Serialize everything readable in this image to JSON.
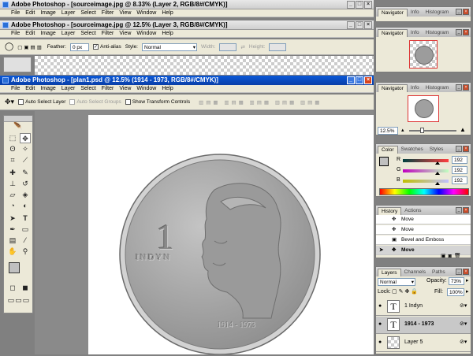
{
  "windows": {
    "w1": {
      "title": "Adobe Photoshop - [sourceimage.jpg @ 8.33% (Layer 2, RGB/8#/CMYK)]"
    },
    "w2": {
      "title": "Adobe Photoshop - [sourceimage.jpg @ 12.5% (Layer 3, RGB/8#/CMYK)]"
    },
    "w3": {
      "title": "Adobe Photoshop - [plan1.psd @ 12.5% (1914 - 1973, RGB/8#/CMYK)]"
    }
  },
  "menu": [
    "File",
    "Edit",
    "Image",
    "Layer",
    "Select",
    "Filter",
    "View",
    "Window",
    "Help"
  ],
  "options_marquee": {
    "feather_label": "Feather:",
    "feather_value": "0 px",
    "antialias_label": "Anti-alias",
    "style_label": "Style:",
    "style_value": "Normal",
    "width_label": "Width:",
    "height_label": "Height:"
  },
  "options_move": {
    "auto_select_layer": "Auto Select Layer",
    "auto_select_groups": "Auto Select Groups",
    "show_transform": "Show Transform Controls"
  },
  "coin": {
    "denomination": "1",
    "currency": "INDYN",
    "years": "1914 - 1973",
    "fill_color": "#a8a8a8"
  },
  "navigator": {
    "tabs": [
      "Navigator",
      "Info",
      "Histogram"
    ],
    "zoom": "12.5%"
  },
  "color_panel": {
    "tabs": [
      "Color",
      "Swatches",
      "Styles"
    ],
    "r_label": "R",
    "g_label": "G",
    "b_label": "B",
    "r_value": "192",
    "g_value": "192",
    "b_value": "192",
    "r_level": 0.753,
    "g_level": 0.753,
    "b_level": 0.753
  },
  "history": {
    "tabs": [
      "History",
      "Actions"
    ],
    "items": [
      "Move",
      "Move",
      "Bevel and Emboss",
      "Move"
    ]
  },
  "layers": {
    "tabs": [
      "Layers",
      "Channels",
      "Paths"
    ],
    "blend_mode": "Normal",
    "opacity_label": "Opacity:",
    "opacity_value": "73%",
    "lock_label": "Lock:",
    "fill_label": "Fill:",
    "fill_value": "100%",
    "items": [
      {
        "name": "1 Indyn"
      },
      {
        "name": "1914 - 1973"
      },
      {
        "name": "Layer 5"
      }
    ]
  }
}
